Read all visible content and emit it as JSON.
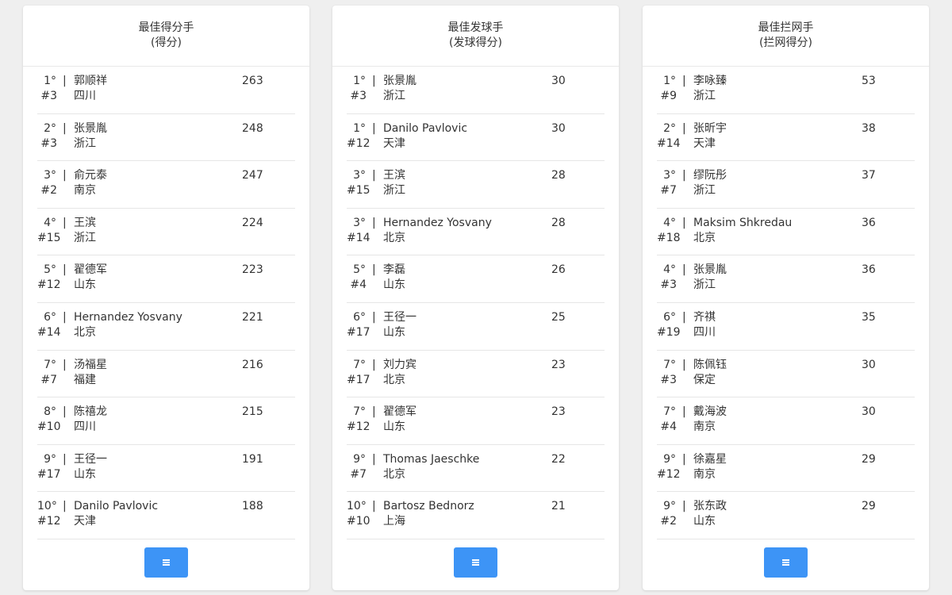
{
  "colors": {
    "background": "#efefef",
    "card": "#ffffff",
    "button": "#3d94f6",
    "text": "#333333",
    "divider": "#e6e6e6"
  },
  "icons": {
    "menu_button": "menu-lines-icon"
  },
  "cards": [
    {
      "title": "最佳得分手",
      "subtitle": "(得分)",
      "rows": [
        {
          "rank": "1°",
          "sep": "|",
          "name": "郭顺祥",
          "number": "#3",
          "team": "四川",
          "score": "263"
        },
        {
          "rank": "2°",
          "sep": "|",
          "name": "张景胤",
          "number": "#3",
          "team": "浙江",
          "score": "248"
        },
        {
          "rank": "3°",
          "sep": "|",
          "name": "俞元泰",
          "number": "#2",
          "team": "南京",
          "score": "247"
        },
        {
          "rank": "4°",
          "sep": "|",
          "name": "王滨",
          "number": "#15",
          "team": "浙江",
          "score": "224"
        },
        {
          "rank": "5°",
          "sep": "|",
          "name": "翟德军",
          "number": "#12",
          "team": "山东",
          "score": "223"
        },
        {
          "rank": "6°",
          "sep": "|",
          "name": "Hernandez Yosvany",
          "number": "#14",
          "team": "北京",
          "score": "221"
        },
        {
          "rank": "7°",
          "sep": "|",
          "name": "汤福星",
          "number": "#7",
          "team": "福建",
          "score": "216"
        },
        {
          "rank": "8°",
          "sep": "|",
          "name": "陈禧龙",
          "number": "#10",
          "team": "四川",
          "score": "215"
        },
        {
          "rank": "9°",
          "sep": "|",
          "name": "王径一",
          "number": "#17",
          "team": "山东",
          "score": "191"
        },
        {
          "rank": "10°",
          "sep": "|",
          "name": "Danilo Pavlovic",
          "number": "#12",
          "team": "天津",
          "score": "188"
        }
      ]
    },
    {
      "title": "最佳发球手",
      "subtitle": "(发球得分)",
      "rows": [
        {
          "rank": "1°",
          "sep": "|",
          "name": "张景胤",
          "number": "#3",
          "team": "浙江",
          "score": "30"
        },
        {
          "rank": "1°",
          "sep": "|",
          "name": "Danilo Pavlovic",
          "number": "#12",
          "team": "天津",
          "score": "30"
        },
        {
          "rank": "3°",
          "sep": "|",
          "name": "王滨",
          "number": "#15",
          "team": "浙江",
          "score": "28"
        },
        {
          "rank": "3°",
          "sep": "|",
          "name": "Hernandez Yosvany",
          "number": "#14",
          "team": "北京",
          "score": "28"
        },
        {
          "rank": "5°",
          "sep": "|",
          "name": "李磊",
          "number": "#4",
          "team": "山东",
          "score": "26"
        },
        {
          "rank": "6°",
          "sep": "|",
          "name": "王径一",
          "number": "#17",
          "team": "山东",
          "score": "25"
        },
        {
          "rank": "7°",
          "sep": "|",
          "name": "刘力宾",
          "number": "#17",
          "team": "北京",
          "score": "23"
        },
        {
          "rank": "7°",
          "sep": "|",
          "name": "翟德军",
          "number": "#12",
          "team": "山东",
          "score": "23"
        },
        {
          "rank": "9°",
          "sep": "|",
          "name": "Thomas Jaeschke",
          "number": "#7",
          "team": "北京",
          "score": "22"
        },
        {
          "rank": "10°",
          "sep": "|",
          "name": "Bartosz Bednorz",
          "number": "#10",
          "team": "上海",
          "score": "21"
        }
      ]
    },
    {
      "title": "最佳拦网手",
      "subtitle": "(拦网得分)",
      "rows": [
        {
          "rank": "1°",
          "sep": "|",
          "name": "李咏臻",
          "number": "#9",
          "team": "浙江",
          "score": "53"
        },
        {
          "rank": "2°",
          "sep": "|",
          "name": "张昕宇",
          "number": "#14",
          "team": "天津",
          "score": "38"
        },
        {
          "rank": "3°",
          "sep": "|",
          "name": "缪阮彤",
          "number": "#7",
          "team": "浙江",
          "score": "37"
        },
        {
          "rank": "4°",
          "sep": "|",
          "name": "Maksim Shkredau",
          "number": "#18",
          "team": "北京",
          "score": "36"
        },
        {
          "rank": "4°",
          "sep": "|",
          "name": "张景胤",
          "number": "#3",
          "team": "浙江",
          "score": "36"
        },
        {
          "rank": "6°",
          "sep": "|",
          "name": "齐祺",
          "number": "#19",
          "team": "四川",
          "score": "35"
        },
        {
          "rank": "7°",
          "sep": "|",
          "name": "陈佩钰",
          "number": "#3",
          "team": "保定",
          "score": "30"
        },
        {
          "rank": "7°",
          "sep": "|",
          "name": "戴海波",
          "number": "#4",
          "team": "南京",
          "score": "30"
        },
        {
          "rank": "9°",
          "sep": "|",
          "name": "徐嘉星",
          "number": "#12",
          "team": "南京",
          "score": "29"
        },
        {
          "rank": "9°",
          "sep": "|",
          "name": "张东政",
          "number": "#2",
          "team": "山东",
          "score": "29"
        }
      ]
    }
  ]
}
